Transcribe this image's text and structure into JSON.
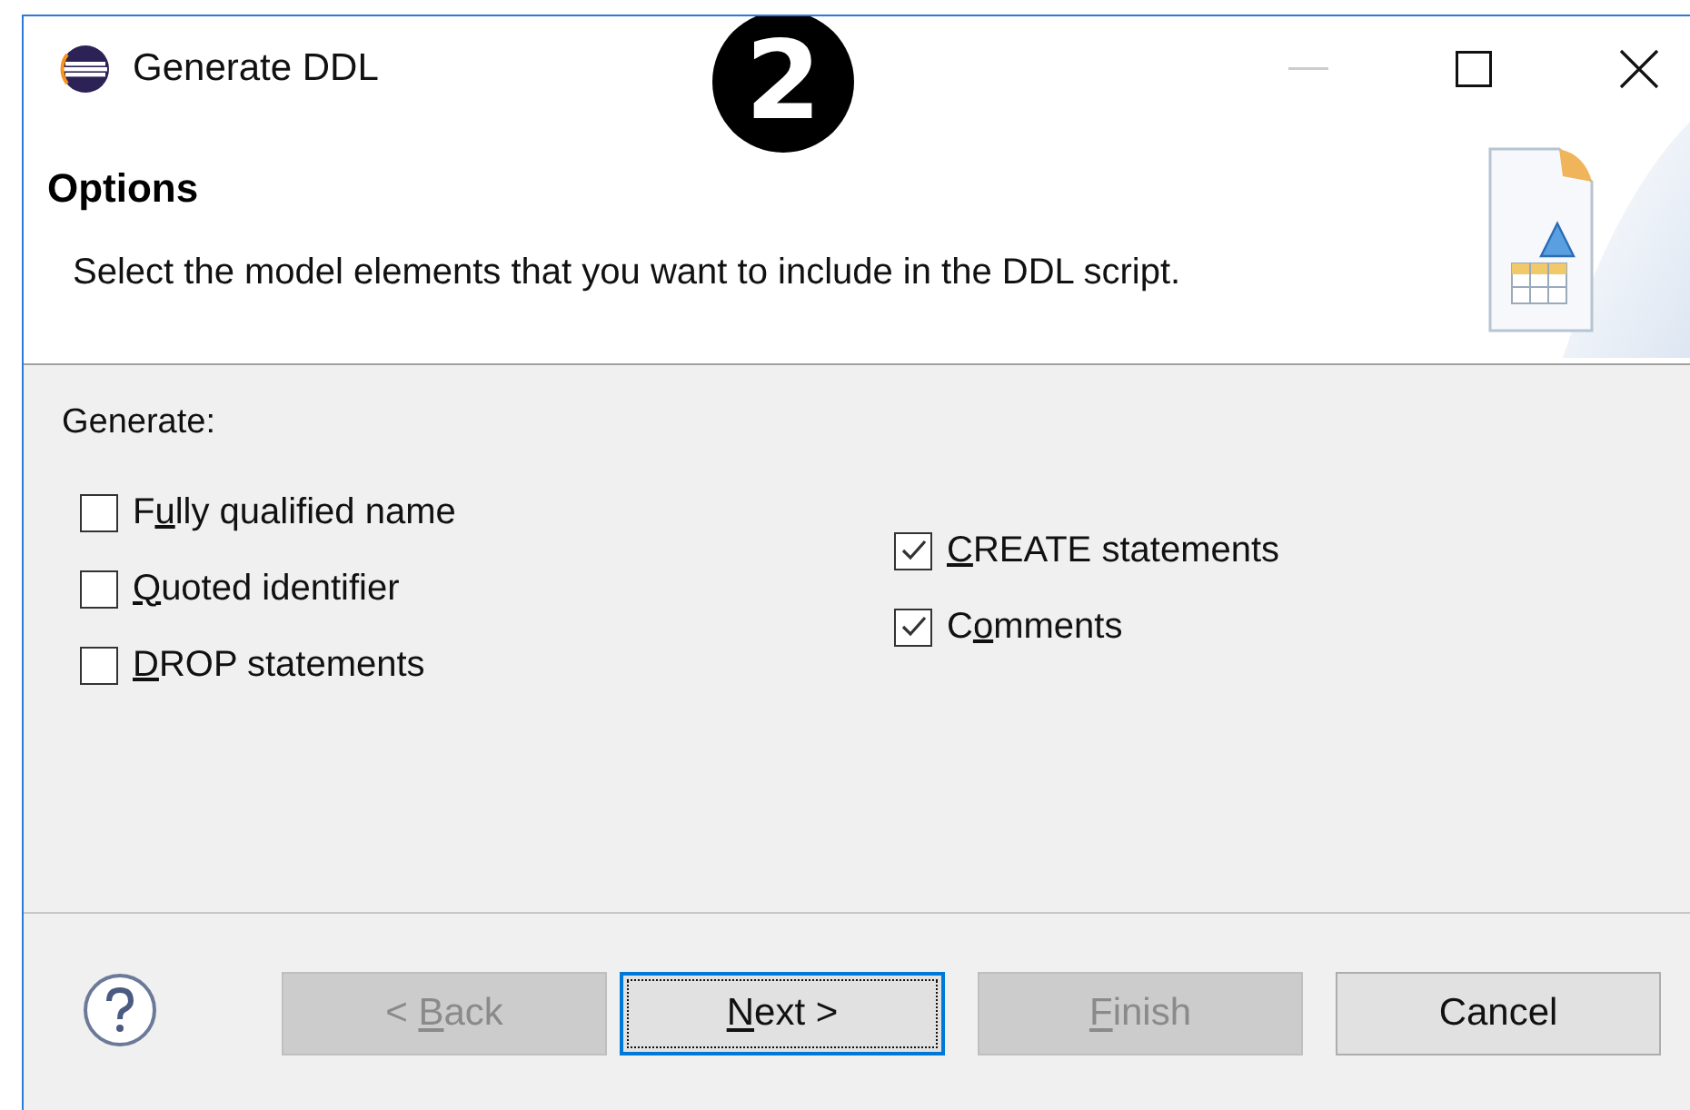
{
  "window": {
    "title": "Generate DDL"
  },
  "callout": "2",
  "header": {
    "title": "Options",
    "description": "Select the model elements that you want to include in the DDL script."
  },
  "group_label": "Generate:",
  "left_options": [
    {
      "label": {
        "pre": "F",
        "key": "u",
        "post": "lly qualified name"
      },
      "checked": false
    },
    {
      "label": {
        "key": "Q",
        "post": "uoted identifier"
      },
      "checked": false
    },
    {
      "label": {
        "key": "D",
        "post": "ROP statements"
      },
      "checked": false
    }
  ],
  "right_options": [
    {
      "label": {
        "key": "C",
        "post": "REATE statements"
      },
      "checked": true
    },
    {
      "label": {
        "pre": "C",
        "key": "o",
        "post": "mments"
      },
      "checked": true
    }
  ],
  "buttons": [
    {
      "label": {
        "pre": "< ",
        "key": "B",
        "post": "ack"
      },
      "disabled": true,
      "default": false
    },
    {
      "label": {
        "key": "N",
        "post": "ext >"
      },
      "disabled": false,
      "default": true
    },
    {
      "label": {
        "key": "F",
        "post": "inish"
      },
      "disabled": true,
      "default": false
    },
    {
      "label": {
        "pre": "Cancel"
      },
      "disabled": false,
      "default": false
    }
  ]
}
